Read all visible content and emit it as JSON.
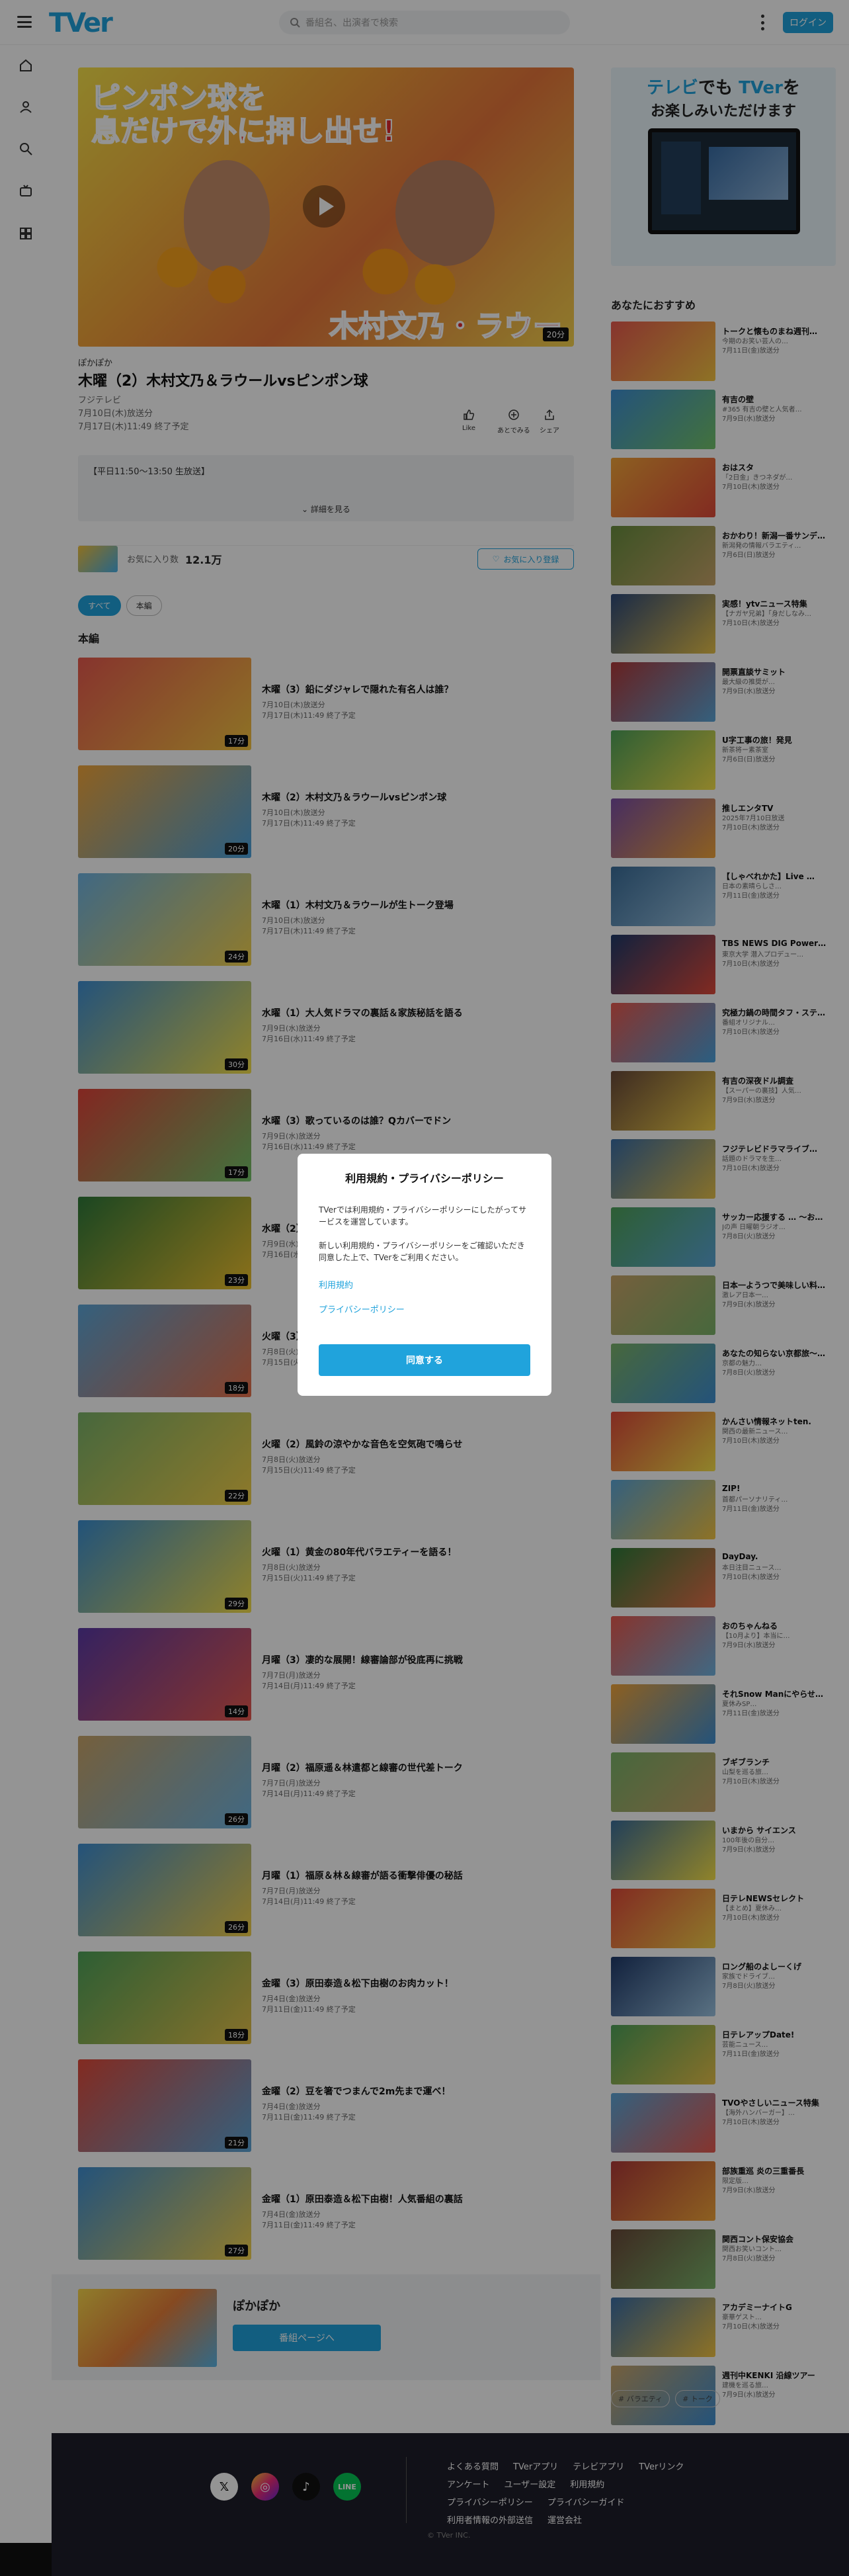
{
  "header": {
    "logo": "TVer",
    "search_placeholder": "番組名、出演者で検索",
    "login": "ログイン"
  },
  "player": {
    "hero_line1": "ピンポン球を",
    "hero_line2": "息だけで外に押し出せ!",
    "hero_line3": "木村文乃・ラウールも参戦!",
    "duration": "20分"
  },
  "episode": {
    "series": "ぽかぽか",
    "title": "木曜（2）木村文乃＆ラウールvsピンポン球",
    "network": "フジテレビ",
    "broadcast": "7月10日(木)放送分",
    "expires": "7月17日(木)11:49 終了予定",
    "actions": [
      "Like",
      "あとでみる",
      "シェア"
    ],
    "description": "【平日11:50～13:50 生放送】",
    "more": "詳細を見る"
  },
  "favorite": {
    "label": "お気に入り数",
    "count": "12.1万",
    "button": "お気に入り登録"
  },
  "chips": [
    "すべて",
    "本編"
  ],
  "section_title": "本編",
  "episodes": [
    {
      "title": "木曜（3）鉛にダジャレで隠れた有名人は誰？",
      "date": "7月10日(木)放送分",
      "exp": "7月17日(木)11:49 終了予定",
      "dur": "17分",
      "c1": "#e85a4f",
      "c2": "#f4c542"
    },
    {
      "title": "木曜（2）木村文乃＆ラウールvsピンポン球",
      "date": "7月10日(木)放送分",
      "exp": "7月17日(木)11:49 終了予定",
      "dur": "20分",
      "c1": "#f2a53a",
      "c2": "#4aa3df"
    },
    {
      "title": "木曜（1）木村文乃＆ラウールが生トーク登場",
      "date": "7月10日(木)放送分",
      "exp": "7月17日(木)11:49 終了予定",
      "dur": "24分",
      "c1": "#6fb4e2",
      "c2": "#f6d34d"
    },
    {
      "title": "水曜（1）大人気ドラマの裏話＆家族秘話を語る",
      "date": "7月9日(水)放送分",
      "exp": "7月16日(水)11:49 終了予定",
      "dur": "30分",
      "c1": "#3f8fd2",
      "c2": "#f7e24a"
    },
    {
      "title": "水曜（3）歌っているのは誰？Qカバーでドン",
      "date": "7月9日(水)放送分",
      "exp": "7月16日(水)11:49 終了予定",
      "dur": "17分",
      "c1": "#e0443a",
      "c2": "#73c46a"
    },
    {
      "title": "水曜（2）今日のゲストは？",
      "date": "7月9日(水)放送分",
      "exp": "7月16日(水)11:49 終了予定",
      "dur": "23分",
      "c1": "#2f7a3a",
      "c2": "#f0c22f"
    },
    {
      "title": "火曜（3）プロが選ぶ！夏のおすすめ",
      "date": "7月8日(火)放送分",
      "exp": "7月15日(火)11:49 終了予定",
      "dur": "18分",
      "c1": "#5ba6d8",
      "c2": "#e8714a"
    },
    {
      "title": "火曜（2）風鈴の涼やかな音色を空気砲で鳴らせ",
      "date": "7月8日(火)放送分",
      "exp": "7月15日(火)11:49 終了予定",
      "dur": "22分",
      "c1": "#7bb36a",
      "c2": "#f4d14a"
    },
    {
      "title": "火曜（1）黄金の80年代バラエティーを語る！",
      "date": "7月8日(火)放送分",
      "exp": "7月15日(火)11:49 終了予定",
      "dur": "29分",
      "c1": "#3b8fd1",
      "c2": "#f7e04a"
    },
    {
      "title": "月曜（3）凄的な展開！線審論部が役底再に挑戦",
      "date": "7月7日(月)放送分",
      "exp": "7月14日(月)11:49 終了予定",
      "dur": "14分",
      "c1": "#5b3aa6",
      "c2": "#e85a4f"
    },
    {
      "title": "月曜（2）福原遥＆林遣都と線審の世代差トーク",
      "date": "7月7日(月)放送分",
      "exp": "7月14日(月)11:49 終了予定",
      "dur": "26分",
      "c1": "#c9a56a",
      "c2": "#6fb4e2"
    },
    {
      "title": "月曜（1）福原＆林＆線審が語る衝撃俳優の秘話",
      "date": "7月7日(月)放送分",
      "exp": "7月14日(月)11:49 終了予定",
      "dur": "26分",
      "c1": "#3f8fd2",
      "c2": "#f4d14a"
    },
    {
      "title": "金曜（3）原田泰造＆松下由樹のお肉カット！",
      "date": "7月4日(金)放送分",
      "exp": "7月11日(金)11:49 終了予定",
      "dur": "18分",
      "c1": "#4fa35a",
      "c2": "#e8c24a"
    },
    {
      "title": "金曜（2）豆を箸でつまんで2m先まで運べ！",
      "date": "7月4日(金)放送分",
      "exp": "7月11日(金)11:49 終了予定",
      "dur": "21分",
      "c1": "#e04a3a",
      "c2": "#5ba6d8"
    },
    {
      "title": "金曜（1）原田泰造＆松下由樹！人気番組の裏話",
      "date": "7月4日(金)放送分",
      "exp": "7月11日(金)11:49 終了予定",
      "dur": "27分",
      "c1": "#3f8fd2",
      "c2": "#f6d34d"
    }
  ],
  "bottom_card": {
    "name": "ぽかぽか",
    "button": "番組ページへ"
  },
  "promo": {
    "line1a": "テレビ",
    "line1b": "でも",
    "line1c": "TVer",
    "line1d": "を",
    "line2": "お楽しみいただけます"
  },
  "recommend_title": "あなたにおすすめ",
  "recommendations": [
    {
      "name": "トークと懐ものまね週刊…",
      "l1": "今期のお笑い芸人の…",
      "l2": "7月11日(金)放送分",
      "c1": "#e85a4f",
      "c2": "#f4c542"
    },
    {
      "name": "有吉の壁",
      "l1": "#365 有吉の壁と人気者…",
      "l2": "7月9日(水)放送分",
      "c1": "#3f8fd2",
      "c2": "#73c46a"
    },
    {
      "name": "おはスタ",
      "l1": "「2日金」きつネダが…",
      "l2": "7月10日(木)放送分",
      "c1": "#f2a53a",
      "c2": "#e04a3a"
    },
    {
      "name": "おかわり！新潟一番サンデ…",
      "l1": "新潟発の情報バラエティ…",
      "l2": "7月6日(日)放送分",
      "c1": "#6a8f3f",
      "c2": "#c9a56a"
    },
    {
      "name": "実感！ytvニュース特集",
      "l1": "【ナガヤ兄弟】「身だしなみ…",
      "l2": "7月10日(木)放送分",
      "c1": "#2e4a7a",
      "c2": "#e8c24a"
    },
    {
      "name": "開票直談サミット",
      "l1": "最大級の推奨が…",
      "l2": "7月9日(水)放送分",
      "c1": "#b03a3a",
      "c2": "#5ba6d8"
    },
    {
      "name": "U字工事の旅！発見",
      "l1": "新茶将ー素茶室",
      "l2": "7月6日(日)放送分",
      "c1": "#4fa35a",
      "c2": "#f7e24a"
    },
    {
      "name": "推しエンタTV",
      "l1": "2025年7月10日放送",
      "l2": "7月10日(木)放送分",
      "c1": "#7b4fa6",
      "c2": "#f2a53a"
    },
    {
      "name": "【しゃべれかた】Live …",
      "l1": "日本の素晴らしさ…",
      "l2": "7月11日(金)放送分",
      "c1": "#3b6e9a",
      "c2": "#9bc4e2"
    },
    {
      "name": "TBS NEWS DIG Power…",
      "l1": "東京大学 潜入プロデュー…",
      "l2": "7月10日(木)放送分",
      "c1": "#1f3a6a",
      "c2": "#e04a3a"
    },
    {
      "name": "究極力鍋の時間タフ・ステ…",
      "l1": "番組オリジナル…",
      "l2": "7月10日(木)放送分",
      "c1": "#e85a4f",
      "c2": "#4aa3df"
    },
    {
      "name": "有吉の深夜ドル調査",
      "l1": "【スーパーの裏技】人気…",
      "l2": "7月9日(水)放送分",
      "c1": "#6a4a3a",
      "c2": "#f4d14a"
    },
    {
      "name": "フジテレビドラマライブ…",
      "l1": "話題のドラマを生…",
      "l2": "7月10日(木)放送分",
      "c1": "#3a6ea6",
      "c2": "#e8c24a"
    },
    {
      "name": "サッカー応援する … ～お…",
      "l1": "Jの声 日曜朝ラジオ…",
      "l2": "7月8日(火)放送分",
      "c1": "#4fa35a",
      "c2": "#5ba6d8"
    },
    {
      "name": "日本一ようつで美味しい料…",
      "l1": "激レア日本一…",
      "l2": "7月9日(水)放送分",
      "c1": "#c9a56a",
      "c2": "#7bb36a"
    },
    {
      "name": "あなたの知らない京都旅～…",
      "l1": "京都の魅力…",
      "l2": "7月8日(火)放送分",
      "c1": "#7bb36a",
      "c2": "#3f8fd2"
    },
    {
      "name": "かんさい情報ネットten.",
      "l1": "関西の最新ニュース…",
      "l2": "7月10日(木)放送分",
      "c1": "#e04a3a",
      "c2": "#f7e24a"
    },
    {
      "name": "ZIP!",
      "l1": "首都パーソナリティ…",
      "l2": "7月11日(金)放送分",
      "c1": "#5ba6d8",
      "c2": "#f4c542"
    },
    {
      "name": "DayDay.",
      "l1": "本日注目ニュース…",
      "l2": "7月10日(木)放送分",
      "c1": "#2f7a3a",
      "c2": "#e8714a"
    },
    {
      "name": "おのちゃんねる",
      "l1": "【10月より】本当に…",
      "l2": "7月9日(水)放送分",
      "c1": "#e85a4f",
      "c2": "#6fb4e2"
    },
    {
      "name": "それSnow Manにやらせ…",
      "l1": "夏休みSP…",
      "l2": "7月11日(金)放送分",
      "c1": "#f2a53a",
      "c2": "#3f8fd2"
    },
    {
      "name": "ブギブランチ",
      "l1": "山梨を巡る旅…",
      "l2": "7月10日(木)放送分",
      "c1": "#7bb36a",
      "c2": "#c9a56a"
    },
    {
      "name": "いまから サイエンス",
      "l1": "100年後の自分…",
      "l2": "7月9日(水)放送分",
      "c1": "#3b6e9a",
      "c2": "#f7e24a"
    },
    {
      "name": "日テレNEWSセレクト",
      "l1": "【まとめ】夏休み…",
      "l2": "7月10日(木)放送分",
      "c1": "#e04a3a",
      "c2": "#f4d14a"
    },
    {
      "name": "ロング船のよしーくげ",
      "l1": "家族でドライブ…",
      "l2": "7月8日(火)放送分",
      "c1": "#1f3a6a",
      "c2": "#9bc4e2"
    },
    {
      "name": "日テレアップDate!",
      "l1": "芸能ニュース…",
      "l2": "7月11日(金)放送分",
      "c1": "#4fa35a",
      "c2": "#e8c24a"
    },
    {
      "name": "TVOやさしいニュース特集",
      "l1": "【海外ハンバーガー】…",
      "l2": "7月10日(木)放送分",
      "c1": "#5ba6d8",
      "c2": "#e85a4f"
    },
    {
      "name": "部族重巡 炎の三重番長",
      "l1": "限定版…",
      "l2": "7月9日(水)放送分",
      "c1": "#b03a3a",
      "c2": "#f2a53a"
    },
    {
      "name": "関西コント保安協会",
      "l1": "関西お笑いコント…",
      "l2": "7月8日(火)放送分",
      "c1": "#6a4a3a",
      "c2": "#7bb36a"
    },
    {
      "name": "アカデミーナイトG",
      "l1": "豪華ゲスト…",
      "l2": "7月10日(木)放送分",
      "c1": "#3a6ea6",
      "c2": "#f4c542"
    },
    {
      "name": "週刊中KENKI 沿線ツアー",
      "l1": "建機を巡る旅…",
      "l2": "7月9日(水)放送分",
      "c1": "#c9a56a",
      "c2": "#3f8fd2"
    }
  ],
  "tags": [
    "バラエティ",
    "トーク"
  ],
  "footer": {
    "links": [
      "よくある質問",
      "TVerアプリ",
      "テレビアプリ",
      "TVerリンク",
      "アンケート",
      "ユーザー設定",
      "利用規約",
      "プライバシーポリシー",
      "プライバシーガイド",
      "利用者情報の外部送信",
      "運営会社"
    ],
    "copyright": "© TVer INC."
  },
  "modal": {
    "title": "利用規約・プライバシーポリシー",
    "p1": "TVerでは利用規約・プライバシーポリシーにしたがってサービスを運営しています。",
    "p2": "新しい利用規約・プライバシーポリシーをご確認いただき同意した上で、TVerをご利用ください。",
    "link_terms": "利用規約",
    "link_privacy": "プライバシーポリシー",
    "agree": "同意する"
  },
  "colors": {
    "accent": "#20a3dc"
  }
}
